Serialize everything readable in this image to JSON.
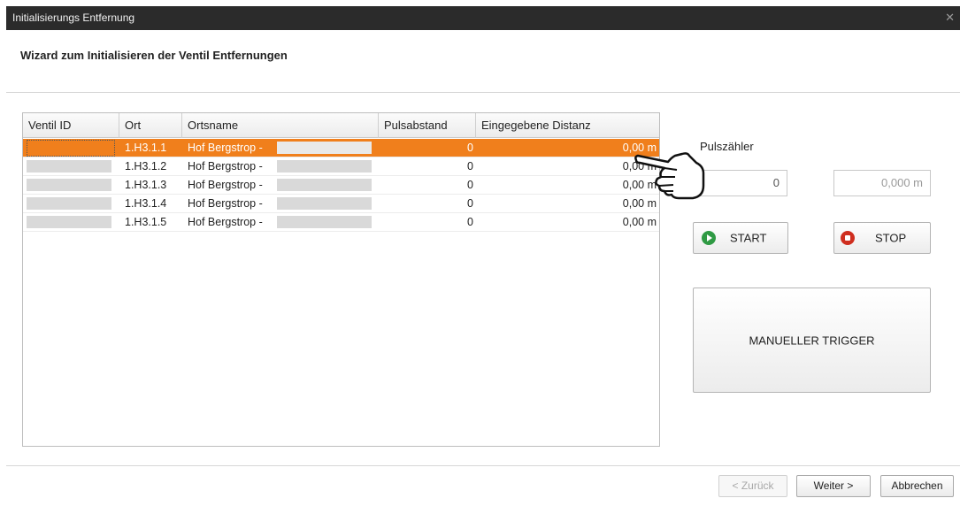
{
  "window": {
    "title": "Initialisierungs Entfernung"
  },
  "header": {
    "heading": "Wizard zum Initialisieren der Ventil Entfernungen"
  },
  "table": {
    "columns": [
      "Ventil ID",
      "Ort",
      "Ortsname",
      "Pulsabstand",
      "Eingegebene Distanz"
    ],
    "rows": [
      {
        "ort": "1.H3.1.1",
        "ortsname": "Hof Bergstrop -",
        "pulsabstand": "0",
        "distanz": "0,00 m",
        "selected": true
      },
      {
        "ort": "1.H3.1.2",
        "ortsname": "Hof Bergstrop -",
        "pulsabstand": "0",
        "distanz": "0,00 m",
        "selected": false
      },
      {
        "ort": "1.H3.1.3",
        "ortsname": "Hof Bergstrop -",
        "pulsabstand": "0",
        "distanz": "0,00 m",
        "selected": false
      },
      {
        "ort": "1.H3.1.4",
        "ortsname": "Hof Bergstrop -",
        "pulsabstand": "0",
        "distanz": "0,00 m",
        "selected": false
      },
      {
        "ort": "1.H3.1.5",
        "ortsname": "Hof Bergstrop -",
        "pulsabstand": "0",
        "distanz": "0,00 m",
        "selected": false
      }
    ]
  },
  "pulszaehler": {
    "label": "Pulszähler",
    "count_value": "0",
    "distance_value": "0,000 m"
  },
  "controls": {
    "start_label": "START",
    "stop_label": "STOP",
    "trigger_label": "MANUELLER TRIGGER"
  },
  "footer": {
    "back_label": "< Zurück",
    "next_label": "Weiter >",
    "cancel_label": "Abbrechen"
  },
  "colors": {
    "selection": "#f07f1c",
    "titlebar": "#2b2b2b",
    "start_icon": "#2f9a44",
    "stop_icon": "#cf2e1f"
  },
  "icons": [
    "close-icon",
    "start-icon",
    "stop-icon",
    "pointing-hand-icon"
  ]
}
